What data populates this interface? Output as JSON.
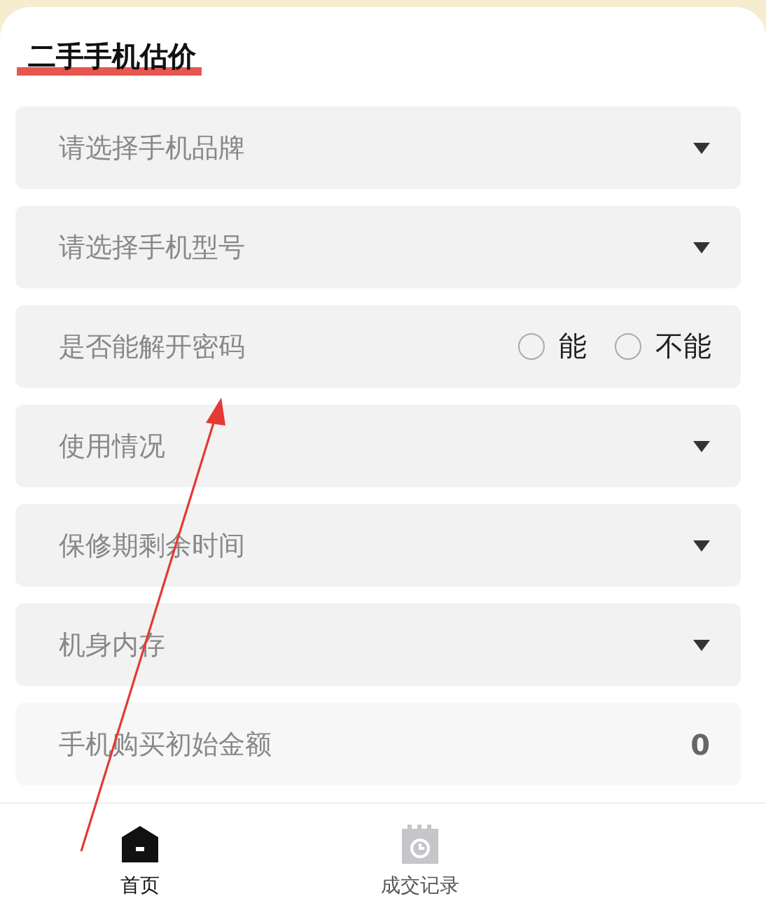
{
  "title": "二手手机估价",
  "fields": [
    {
      "kind": "select",
      "placeholder": "请选择手机品牌"
    },
    {
      "kind": "select",
      "placeholder": "请选择手机型号"
    },
    {
      "kind": "radio",
      "label": "是否能解开密码",
      "options": [
        {
          "label": "能",
          "selected": false
        },
        {
          "label": "不能",
          "selected": false
        }
      ]
    },
    {
      "kind": "select",
      "placeholder": "使用情况"
    },
    {
      "kind": "select",
      "placeholder": "保修期剩余时间"
    },
    {
      "kind": "select",
      "placeholder": "机身内存"
    },
    {
      "kind": "input",
      "label": "手机购买初始金额",
      "value": "0"
    }
  ],
  "tab_bar": [
    {
      "label": "首页",
      "selected": true
    },
    {
      "label": "成交记录",
      "selected": false
    }
  ]
}
